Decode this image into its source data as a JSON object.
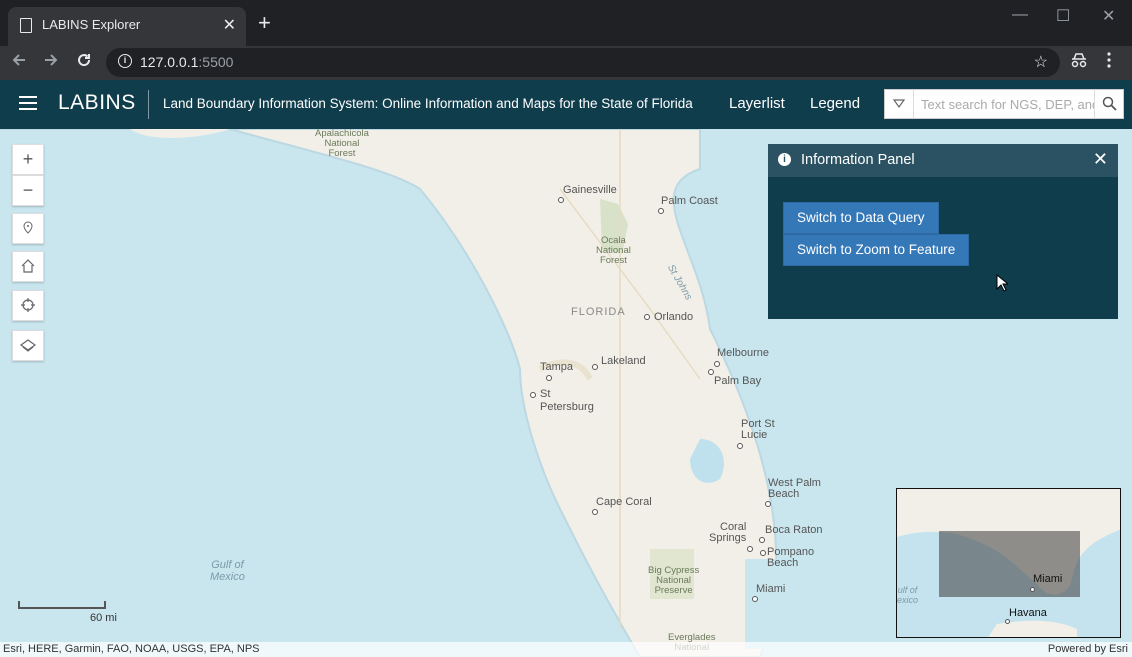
{
  "browser": {
    "tab_title": "LABINS Explorer",
    "tab_close": "✕",
    "new_tab": "+",
    "url_host": "127.0.0.1",
    "url_port": ":5500",
    "win_min": "—",
    "win_max": "☐",
    "win_close": "✕"
  },
  "header": {
    "brand": "LABINS",
    "subtitle": "Land Boundary Information System: Online Information and Maps for the State of Florida",
    "links": [
      "Layerlist",
      "Legend"
    ],
    "search_placeholder": "Text search for NGS, DEP, and..."
  },
  "map": {
    "labels": {
      "apalachicola": "Apalachicola\nNational\nForest",
      "gainesville": "Gainesville",
      "palm_coast": "Palm Coast",
      "ocala": "Ocala\nNational\nForest",
      "st_johns": "St Johns",
      "florida": "FLORIDA",
      "orlando": "Orlando",
      "melbourne": "Melbourne",
      "tampa": "Tampa",
      "lakeland": "Lakeland",
      "palm_bay": "Palm Bay",
      "st_petersburg": "St\nPetersburg",
      "port_st_lucie": "Port St\nLucie",
      "west_palm_beach": "West Palm\nBeach",
      "cape_coral": "Cape Coral",
      "coral_springs": "Coral\nSprings",
      "boca_raton": "Boca Raton",
      "pompano_beach": "Pompano\nBeach",
      "gulf_of_mexico": "Gulf of\nMexico",
      "big_cypress": "Big Cypress\nNational\nPreserve",
      "miami": "Miami",
      "everglades": "Everglades\nNational"
    },
    "scale_label": "60 mi",
    "attribution_left": "Esri, HERE, Garmin, FAO, NOAA, USGS, EPA, NPS",
    "attribution_right": "Powered by Esri"
  },
  "info_panel": {
    "title": "Information Panel",
    "buttons": [
      "Switch to Data Query",
      "Switch to Zoom to Feature"
    ]
  },
  "overview": {
    "labels": {
      "miami": "Miami",
      "havana": "Havana",
      "gulf": "ulf of\nexico"
    }
  },
  "colors": {
    "header_bg": "#0f3d4c",
    "panel_button": "#3578b8",
    "water": "#c9e6ef",
    "land": "#f1efe7"
  }
}
